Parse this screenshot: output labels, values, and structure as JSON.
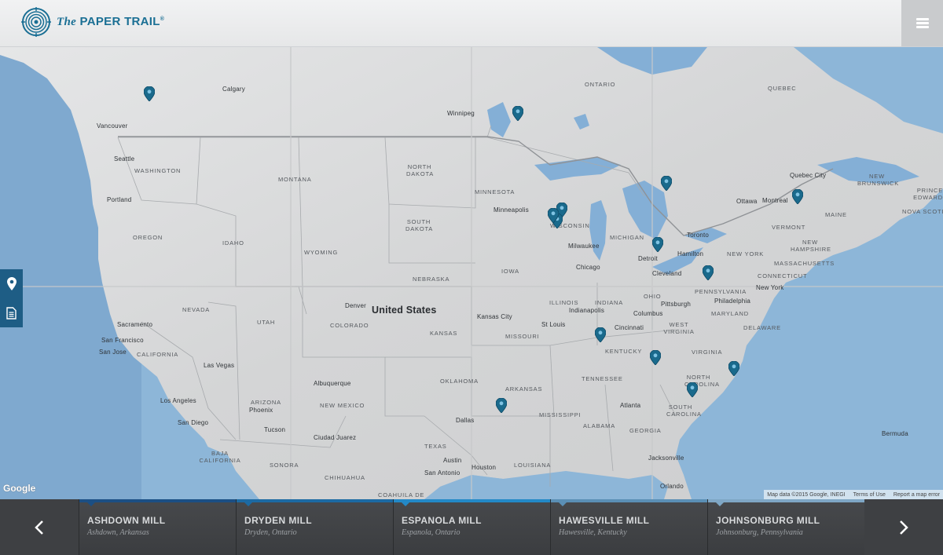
{
  "header": {
    "brand_prefix": "The",
    "brand_name": "PAPER TRAIL",
    "brand_mark": "®",
    "menu_icon": "hamburger-menu-icon"
  },
  "map": {
    "country_label": "United States",
    "cities": [
      "Calgary",
      "Vancouver",
      "Seattle",
      "Portland",
      "Winnipeg",
      "Minneapolis",
      "Milwaukee",
      "Chicago",
      "Detroit",
      "Toronto",
      "Hamilton",
      "Cleveland",
      "Ottawa",
      "Montreal",
      "Quebec City",
      "New York",
      "Philadelphia",
      "Pittsburgh",
      "Columbus",
      "Indianapolis",
      "Cincinnati",
      "St Louis",
      "Kansas City",
      "Denver",
      "Sacramento",
      "San Francisco",
      "San Jose",
      "Las Vegas",
      "Los Angeles",
      "San Diego",
      "Phoenix",
      "Tucson",
      "Albuquerque",
      "Ciudad Juarez",
      "Dallas",
      "Austin",
      "San Antonio",
      "Houston",
      "Atlanta",
      "Jacksonville",
      "Orlando",
      "Bermuda"
    ],
    "regions": [
      "ONTARIO",
      "QUEBEC",
      "WASHINGTON",
      "MONTANA",
      "NORTH DAKOTA",
      "MINNESOTA",
      "SOUTH DAKOTA",
      "IDAHO",
      "OREGON",
      "WYOMING",
      "WISCONSIN",
      "MICHIGAN",
      "NEBRASKA",
      "IOWA",
      "NEVADA",
      "UTAH",
      "COLORADO",
      "KANSAS",
      "MISSOURI",
      "ILLINOIS",
      "INDIANA",
      "OHIO",
      "PENNSYLVANIA",
      "NEW YORK",
      "VERMONT",
      "NEW HAMPSHIRE",
      "MASSACHUSETTS",
      "CONNECTICUT",
      "MAINE",
      "NEW BRUNSWICK",
      "NOVA SCOTIA",
      "PRINCE EDWARD ISLAND",
      "MARYLAND",
      "DELAWARE",
      "WEST VIRGINIA",
      "VIRGINIA",
      "KENTUCKY",
      "TENNESSEE",
      "NORTH CAROLINA",
      "SOUTH CAROLINA",
      "GEORGIA",
      "ALABAMA",
      "MISSISSIPPI",
      "ARKANSAS",
      "OKLAHOMA",
      "TEXAS",
      "LOUISIANA",
      "NEW MEXICO",
      "ARIZONA",
      "CALIFORNIA",
      "BAJA CALIFORNIA",
      "SONORA",
      "CHIHUAHUA",
      "COAHUILA DE"
    ],
    "google_logo": "Google",
    "attribution": [
      "Map data ©2015 Google, INEGI",
      "Terms of Use",
      "Report a map error"
    ],
    "pin_color": "#1a6a8c",
    "pin_count": 14
  },
  "side_tools": [
    {
      "icon": "location-pin-icon"
    },
    {
      "icon": "document-icon"
    }
  ],
  "carousel": {
    "prev_icon": "chevron-left-icon",
    "next_icon": "chevron-right-icon",
    "mills": [
      {
        "name": "ASHDOWN MILL",
        "location": "Ashdown, Arkansas",
        "color": "#1b4f84"
      },
      {
        "name": "DRYDEN MILL",
        "location": "Dryden, Ontario",
        "color": "#1c6aa3"
      },
      {
        "name": "ESPANOLA MILL",
        "location": "Espanola, Ontario",
        "color": "#2389c7"
      },
      {
        "name": "HAWESVILLE MILL",
        "location": "Hawesville, Kentucky",
        "color": "#5b8fb5"
      },
      {
        "name": "JOHNSONBURG MILL",
        "location": "Johnsonburg, Pennsylvania",
        "color": "#7fa7c5"
      }
    ]
  }
}
